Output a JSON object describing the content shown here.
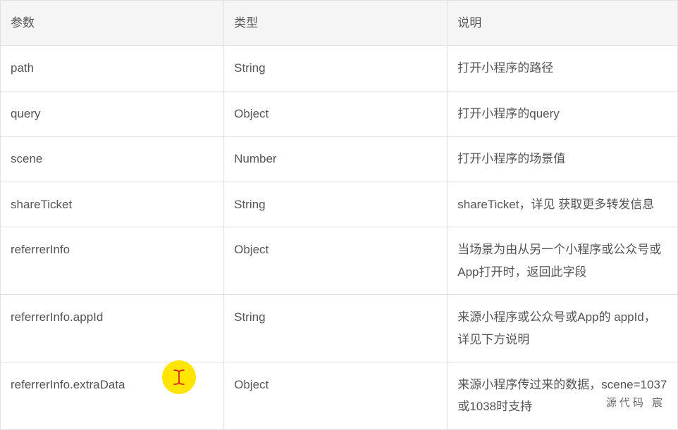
{
  "headers": {
    "col1": "参数",
    "col2": "类型",
    "col3": "说明"
  },
  "rows": [
    {
      "param": "path",
      "type": "String",
      "desc": "打开小程序的路径"
    },
    {
      "param": "query",
      "type": "Object",
      "desc": "打开小程序的query"
    },
    {
      "param": "scene",
      "type": "Number",
      "desc": "打开小程序的场景值"
    },
    {
      "param": "shareTicket",
      "type": "String",
      "desc": "shareTicket，详见 获取更多转发信息"
    },
    {
      "param": "referrerInfo",
      "type": "Object",
      "desc": "当场景为由从另一个小程序或公众号或App打开时，返回此字段"
    },
    {
      "param": "referrerInfo.appId",
      "type": "String",
      "desc": "来源小程序或公众号或App的 appId，详见下方说明"
    },
    {
      "param": "referrerInfo.extraData",
      "type": "Object",
      "desc": "来源小程序传过来的数据，scene=1037或1038时支持"
    }
  ],
  "watermark": "源代码  宸"
}
